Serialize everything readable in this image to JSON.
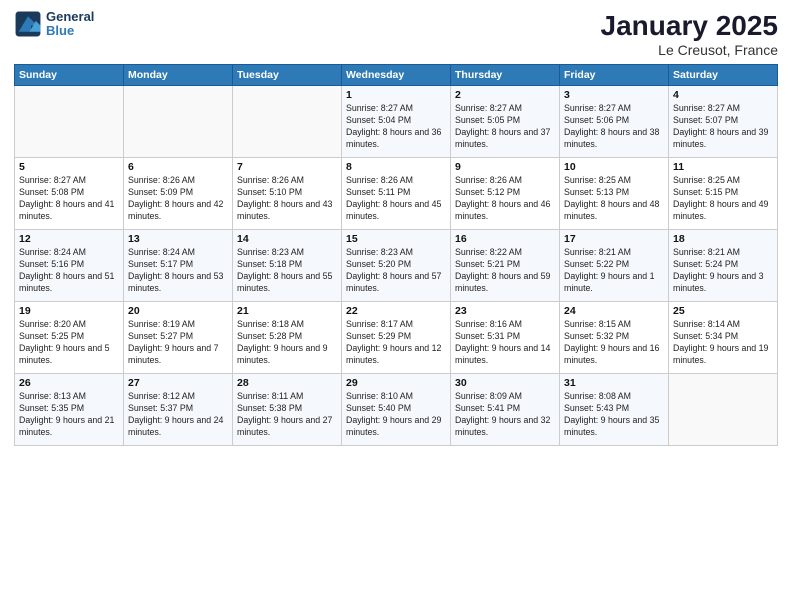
{
  "header": {
    "logo_line1": "General",
    "logo_line2": "Blue",
    "month_title": "January 2025",
    "location": "Le Creusot, France"
  },
  "columns": [
    "Sunday",
    "Monday",
    "Tuesday",
    "Wednesday",
    "Thursday",
    "Friday",
    "Saturday"
  ],
  "weeks": [
    [
      {
        "day": "",
        "info": ""
      },
      {
        "day": "",
        "info": ""
      },
      {
        "day": "",
        "info": ""
      },
      {
        "day": "1",
        "info": "Sunrise: 8:27 AM\nSunset: 5:04 PM\nDaylight: 8 hours and 36 minutes."
      },
      {
        "day": "2",
        "info": "Sunrise: 8:27 AM\nSunset: 5:05 PM\nDaylight: 8 hours and 37 minutes."
      },
      {
        "day": "3",
        "info": "Sunrise: 8:27 AM\nSunset: 5:06 PM\nDaylight: 8 hours and 38 minutes."
      },
      {
        "day": "4",
        "info": "Sunrise: 8:27 AM\nSunset: 5:07 PM\nDaylight: 8 hours and 39 minutes."
      }
    ],
    [
      {
        "day": "5",
        "info": "Sunrise: 8:27 AM\nSunset: 5:08 PM\nDaylight: 8 hours and 41 minutes."
      },
      {
        "day": "6",
        "info": "Sunrise: 8:26 AM\nSunset: 5:09 PM\nDaylight: 8 hours and 42 minutes."
      },
      {
        "day": "7",
        "info": "Sunrise: 8:26 AM\nSunset: 5:10 PM\nDaylight: 8 hours and 43 minutes."
      },
      {
        "day": "8",
        "info": "Sunrise: 8:26 AM\nSunset: 5:11 PM\nDaylight: 8 hours and 45 minutes."
      },
      {
        "day": "9",
        "info": "Sunrise: 8:26 AM\nSunset: 5:12 PM\nDaylight: 8 hours and 46 minutes."
      },
      {
        "day": "10",
        "info": "Sunrise: 8:25 AM\nSunset: 5:13 PM\nDaylight: 8 hours and 48 minutes."
      },
      {
        "day": "11",
        "info": "Sunrise: 8:25 AM\nSunset: 5:15 PM\nDaylight: 8 hours and 49 minutes."
      }
    ],
    [
      {
        "day": "12",
        "info": "Sunrise: 8:24 AM\nSunset: 5:16 PM\nDaylight: 8 hours and 51 minutes."
      },
      {
        "day": "13",
        "info": "Sunrise: 8:24 AM\nSunset: 5:17 PM\nDaylight: 8 hours and 53 minutes."
      },
      {
        "day": "14",
        "info": "Sunrise: 8:23 AM\nSunset: 5:18 PM\nDaylight: 8 hours and 55 minutes."
      },
      {
        "day": "15",
        "info": "Sunrise: 8:23 AM\nSunset: 5:20 PM\nDaylight: 8 hours and 57 minutes."
      },
      {
        "day": "16",
        "info": "Sunrise: 8:22 AM\nSunset: 5:21 PM\nDaylight: 8 hours and 59 minutes."
      },
      {
        "day": "17",
        "info": "Sunrise: 8:21 AM\nSunset: 5:22 PM\nDaylight: 9 hours and 1 minute."
      },
      {
        "day": "18",
        "info": "Sunrise: 8:21 AM\nSunset: 5:24 PM\nDaylight: 9 hours and 3 minutes."
      }
    ],
    [
      {
        "day": "19",
        "info": "Sunrise: 8:20 AM\nSunset: 5:25 PM\nDaylight: 9 hours and 5 minutes."
      },
      {
        "day": "20",
        "info": "Sunrise: 8:19 AM\nSunset: 5:27 PM\nDaylight: 9 hours and 7 minutes."
      },
      {
        "day": "21",
        "info": "Sunrise: 8:18 AM\nSunset: 5:28 PM\nDaylight: 9 hours and 9 minutes."
      },
      {
        "day": "22",
        "info": "Sunrise: 8:17 AM\nSunset: 5:29 PM\nDaylight: 9 hours and 12 minutes."
      },
      {
        "day": "23",
        "info": "Sunrise: 8:16 AM\nSunset: 5:31 PM\nDaylight: 9 hours and 14 minutes."
      },
      {
        "day": "24",
        "info": "Sunrise: 8:15 AM\nSunset: 5:32 PM\nDaylight: 9 hours and 16 minutes."
      },
      {
        "day": "25",
        "info": "Sunrise: 8:14 AM\nSunset: 5:34 PM\nDaylight: 9 hours and 19 minutes."
      }
    ],
    [
      {
        "day": "26",
        "info": "Sunrise: 8:13 AM\nSunset: 5:35 PM\nDaylight: 9 hours and 21 minutes."
      },
      {
        "day": "27",
        "info": "Sunrise: 8:12 AM\nSunset: 5:37 PM\nDaylight: 9 hours and 24 minutes."
      },
      {
        "day": "28",
        "info": "Sunrise: 8:11 AM\nSunset: 5:38 PM\nDaylight: 9 hours and 27 minutes."
      },
      {
        "day": "29",
        "info": "Sunrise: 8:10 AM\nSunset: 5:40 PM\nDaylight: 9 hours and 29 minutes."
      },
      {
        "day": "30",
        "info": "Sunrise: 8:09 AM\nSunset: 5:41 PM\nDaylight: 9 hours and 32 minutes."
      },
      {
        "day": "31",
        "info": "Sunrise: 8:08 AM\nSunset: 5:43 PM\nDaylight: 9 hours and 35 minutes."
      },
      {
        "day": "",
        "info": ""
      }
    ]
  ]
}
